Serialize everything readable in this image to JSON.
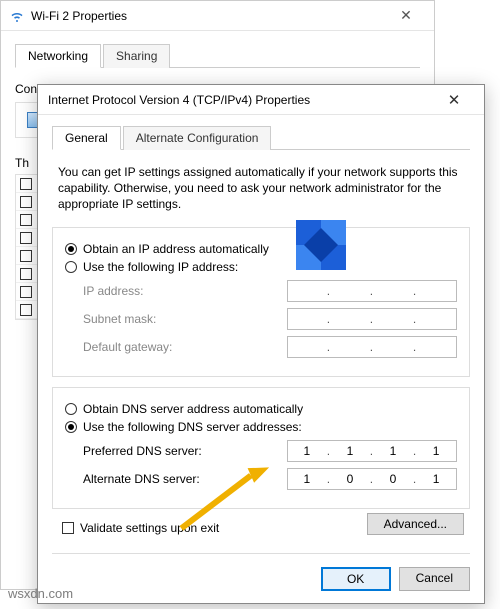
{
  "parent": {
    "title": "Wi-Fi 2 Properties",
    "tabs": {
      "networking": "Networking",
      "sharing": "Sharing"
    },
    "connect_using": "Connect using:",
    "this_label": "Th"
  },
  "child": {
    "title": "Internet Protocol Version 4 (TCP/IPv4) Properties",
    "tabs": {
      "general": "General",
      "alt": "Alternate Configuration"
    },
    "description": "You can get IP settings assigned automatically if your network supports this capability. Otherwise, you need to ask your network administrator for the appropriate IP settings.",
    "ip": {
      "auto": "Obtain an IP address automatically",
      "manual": "Use the following IP address:",
      "address_label": "IP address:",
      "subnet_label": "Subnet mask:",
      "gateway_label": "Default gateway:"
    },
    "dns": {
      "auto": "Obtain DNS server address automatically",
      "manual": "Use the following DNS server addresses:",
      "preferred_label": "Preferred DNS server:",
      "alternate_label": "Alternate DNS server:",
      "preferred": [
        "1",
        "1",
        "1",
        "1"
      ],
      "alternate": [
        "1",
        "0",
        "0",
        "1"
      ]
    },
    "validate": "Validate settings upon exit",
    "advanced": "Advanced...",
    "ok": "OK",
    "cancel": "Cancel"
  },
  "watermark": "wsxdn.com"
}
